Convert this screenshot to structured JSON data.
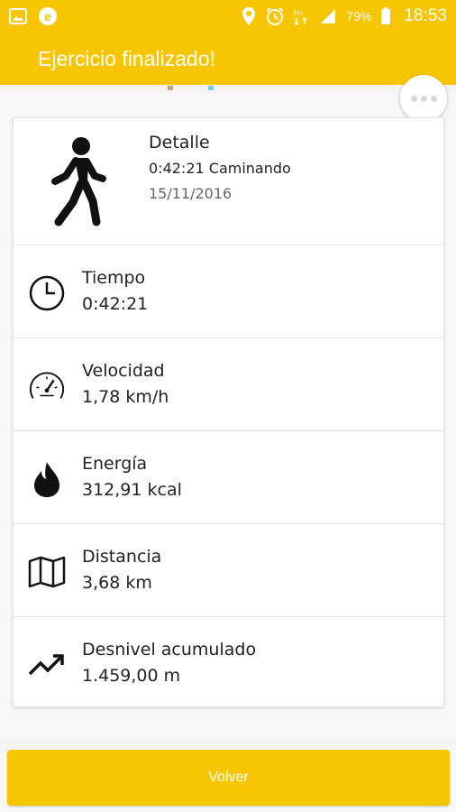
{
  "status_bar": {
    "battery_percent": "79%",
    "time": "18:53",
    "icons": [
      "image-icon",
      "app-e-icon",
      "location-pin-icon",
      "alarm-icon",
      "hd-signal-icon",
      "cell-signal-icon",
      "battery-icon"
    ]
  },
  "app_bar": {
    "title": "Ejercicio finalizado!"
  },
  "summary": {
    "title": "Detalle",
    "subtitle": "0:42:21 Caminando",
    "date": "15/11/2016",
    "icon": "walking-person-icon"
  },
  "stats": [
    {
      "label": "Tiempo",
      "value": "0:42:21",
      "icon": "clock-icon"
    },
    {
      "label": "Velocidad",
      "value": "1,78 km/h",
      "icon": "speedometer-icon"
    },
    {
      "label": "Energía",
      "value": "312,91 kcal",
      "icon": "flame-icon"
    },
    {
      "label": "Distancia",
      "value": "3,68 km",
      "icon": "map-icon"
    },
    {
      "label": "Desnivel acumulado",
      "value": "1.459,00 m",
      "icon": "trending-up-icon"
    }
  ],
  "footer": {
    "button_label": "Volver"
  },
  "colors": {
    "brand": "#f7c600",
    "text": "#222222",
    "muted": "#666666"
  }
}
